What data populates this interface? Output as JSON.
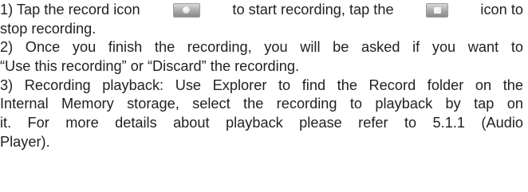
{
  "step1": {
    "part1": "1) Tap the record icon",
    "part2": "to start recording, tap the",
    "part3": "icon to",
    "line2": "stop recording.",
    "record_icon": "record-icon",
    "stop_icon": "stop-icon"
  },
  "step2": {
    "line1": "2) Once you finish the recording, you will be asked if you want to",
    "line2": "“Use this recording” or “Discard” the recording."
  },
  "step3": {
    "line1": "3) Recording playback: Use Explorer to find the Record folder on the",
    "line2": "Internal Memory storage, select the recording to playback by tap on",
    "line3": "it. For more details about playback please refer to 5.1.1 (Audio",
    "line4": "Player)."
  }
}
